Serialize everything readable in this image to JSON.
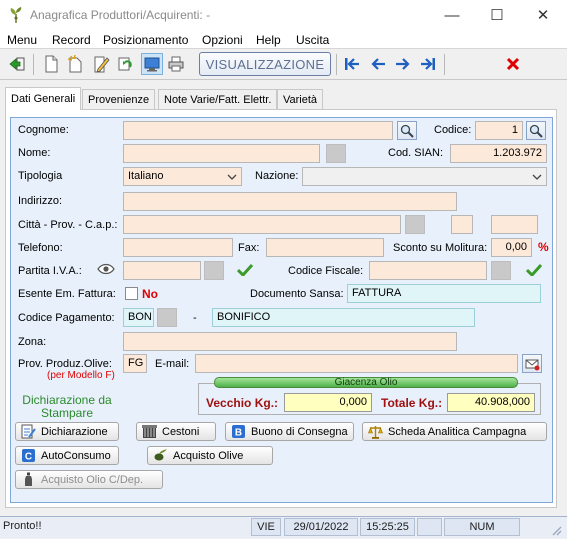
{
  "window": {
    "title": "Anagrafica Produttori/Acquirenti: -",
    "minimize_symbol": "—",
    "maximize_symbol": "☐",
    "close_symbol": "✕"
  },
  "menu": [
    "Menu",
    "Record",
    "Posizionamento",
    "Opzioni",
    "Help",
    "Uscita"
  ],
  "toolbar": {
    "mode_label": "VISUALIZZAZIONE",
    "icons": [
      "exit-icon",
      "new-document-icon",
      "new-folder-icon",
      "edit-icon",
      "copy-icon",
      "view-icon",
      "print-icon",
      "first-record-icon",
      "previous-record-icon",
      "next-record-icon",
      "last-record-icon",
      "delete-icon"
    ]
  },
  "tabs": [
    "Dati Generali",
    "Provenienze",
    "Note Varie/Fatt. Elettr.",
    "Varietà"
  ],
  "form": {
    "cognome_label": "Cognome:",
    "cognome_value": "",
    "codice_label": "Codice:",
    "codice_value": "1",
    "nome_label": "Nome:",
    "nome_value": "",
    "cod_sian_label": "Cod. SIAN:",
    "cod_sian_value": "1.203.972",
    "tipologia_label": "Tipologia",
    "tipologia_value": "Italiano",
    "nazione_label": "Nazione:",
    "nazione_value": "",
    "indirizzo_label": "Indirizzo:",
    "indirizzo_value": "",
    "citta_label": "Città - Prov. - C.a.p.:",
    "citta_value": "",
    "prov_value": "",
    "cap_value": "",
    "telefono_label": "Telefono:",
    "telefono_value": "",
    "fax_label": "Fax:",
    "fax_value": "",
    "sconto_label": "Sconto su Molitura:",
    "sconto_value": "0,00",
    "percent_symbol": "%",
    "piva_label": "Partita I.V.A.:",
    "piva_value": "",
    "cf_label": "Codice Fiscale:",
    "cf_value": "",
    "esente_label": "Esente Em. Fattura:",
    "esente_value": "No",
    "doc_sansa_label": "Documento Sansa:",
    "doc_sansa_value": "FATTURA",
    "cod_pagamento_label": "Codice Pagamento:",
    "cod_pagamento_code": "BON",
    "cod_pagamento_dash": "-",
    "cod_pagamento_desc": "BONIFICO",
    "zona_label": "Zona:",
    "zona_value": "",
    "prov_produz_label": "Prov. Produz.Olive:",
    "prov_produz_note": "(per Modello F)",
    "prov_produz_value": "FG",
    "email_label": "E-mail:",
    "email_value": "",
    "dichiarazione_text_line1": "Dichiarazione da",
    "dichiarazione_text_line2": "Stampare"
  },
  "giacenza": {
    "title": "Giacenza Olio",
    "vecchio_label": "Vecchio Kg.:",
    "vecchio_value": "0,000",
    "totale_label": "Totale Kg.:",
    "totale_value": "40.908,000"
  },
  "buttons": {
    "dichiarazione": "Dichiarazione",
    "cestoni": "Cestoni",
    "buono": "Buono di Consegna",
    "scheda": "Scheda Analitica Campagna",
    "autoconsumo": "AutoConsumo",
    "acquisto_olive": "Acquisto Olive",
    "acquisto_olio": "Acquisto Olio C/Dep."
  },
  "status": {
    "message": "Pronto!!",
    "day": "VIE",
    "date": "29/01/2022",
    "time": "15:25:25",
    "num": "NUM"
  },
  "colors": {
    "accent_blue": "#7fa8d8",
    "input_peach": "#fde9d9",
    "input_cyan": "#dff5f8",
    "input_yellow": "#ffffc0",
    "red": "#e00000",
    "green": "#4fb04a"
  }
}
